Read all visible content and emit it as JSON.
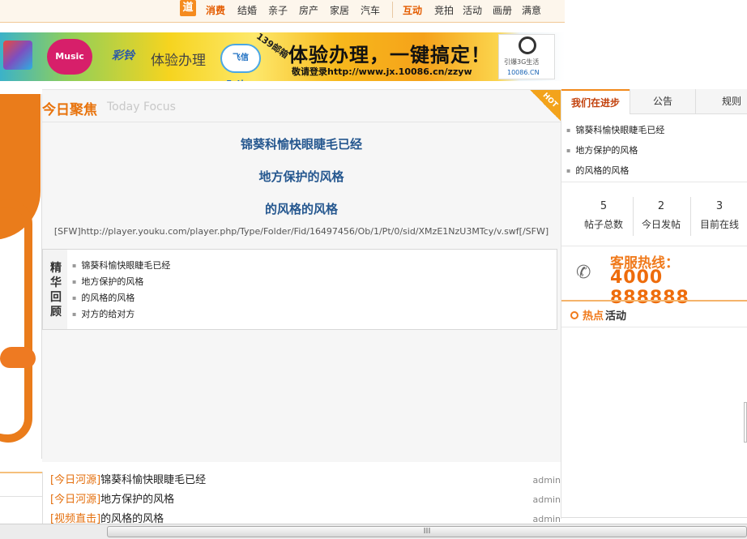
{
  "topnav": {
    "dao": "道",
    "group1": [
      "消费",
      "结婚",
      "亲子",
      "房产",
      "家居",
      "汽车"
    ],
    "group2": [
      "互动",
      "竞拍",
      "活动",
      "画册",
      "满意"
    ]
  },
  "banner": {
    "music": "Music",
    "caiyin": "彩铃",
    "tiyan_small": "体验办理",
    "fetion": "飞信 Fetion",
    "mailbox": "139邮箱",
    "headline": "体验办理，一键搞定！",
    "url": "敬请登录http://www.jx.10086.cn/zzyw",
    "g3_text": "引爆3G生活",
    "g3_url": "10086.CN"
  },
  "focus": {
    "title_cn": "今日聚焦",
    "title_en": "Today Focus",
    "hot": "HOT",
    "headlines": [
      "锦葵科愉快眼睫毛已经",
      "地方保护的风格",
      "的风格的风格"
    ],
    "swf": "[SFW]http://player.youku.com/player.php/Type/Folder/Fid/16497456/Ob/1/Pt/0/sid/XMzE1NzU3MTcy/v.swf[/SFW]",
    "review_label": "精华回顾",
    "review_items": [
      "锦葵科愉快眼睫毛已经",
      "地方保护的风格",
      "的风格的风格",
      "对方的给对方"
    ]
  },
  "bottom_list": [
    {
      "cat": "[今日河源]",
      "title": "锦葵科愉快眼睫毛已经",
      "author": "admin"
    },
    {
      "cat": "[今日河源]",
      "title": "地方保护的风格",
      "author": "admin"
    },
    {
      "cat": "[视频直击]",
      "title": "的风格的风格",
      "author": "admin"
    }
  ],
  "sidebar": {
    "tabs": [
      "我们在进步",
      "公告",
      "规则"
    ],
    "news": [
      "锦葵科愉快眼睫毛已经",
      "地方保护的风格",
      "的风格的风格"
    ],
    "stats": [
      {
        "num": "5",
        "label": "帖子总数"
      },
      {
        "num": "2",
        "label": "今日发帖"
      },
      {
        "num": "3",
        "label": "目前在线"
      }
    ],
    "hotline_label": "客服热线：",
    "hotline_number": "4000 888888",
    "hot_activity_1": "热点",
    "hot_activity_2": "活动"
  },
  "scrollbar": {
    "grip": "III"
  },
  "colors": {
    "accent": "#e8730c",
    "link_blue": "#25578f",
    "hot_orange": "#f3a31b"
  }
}
